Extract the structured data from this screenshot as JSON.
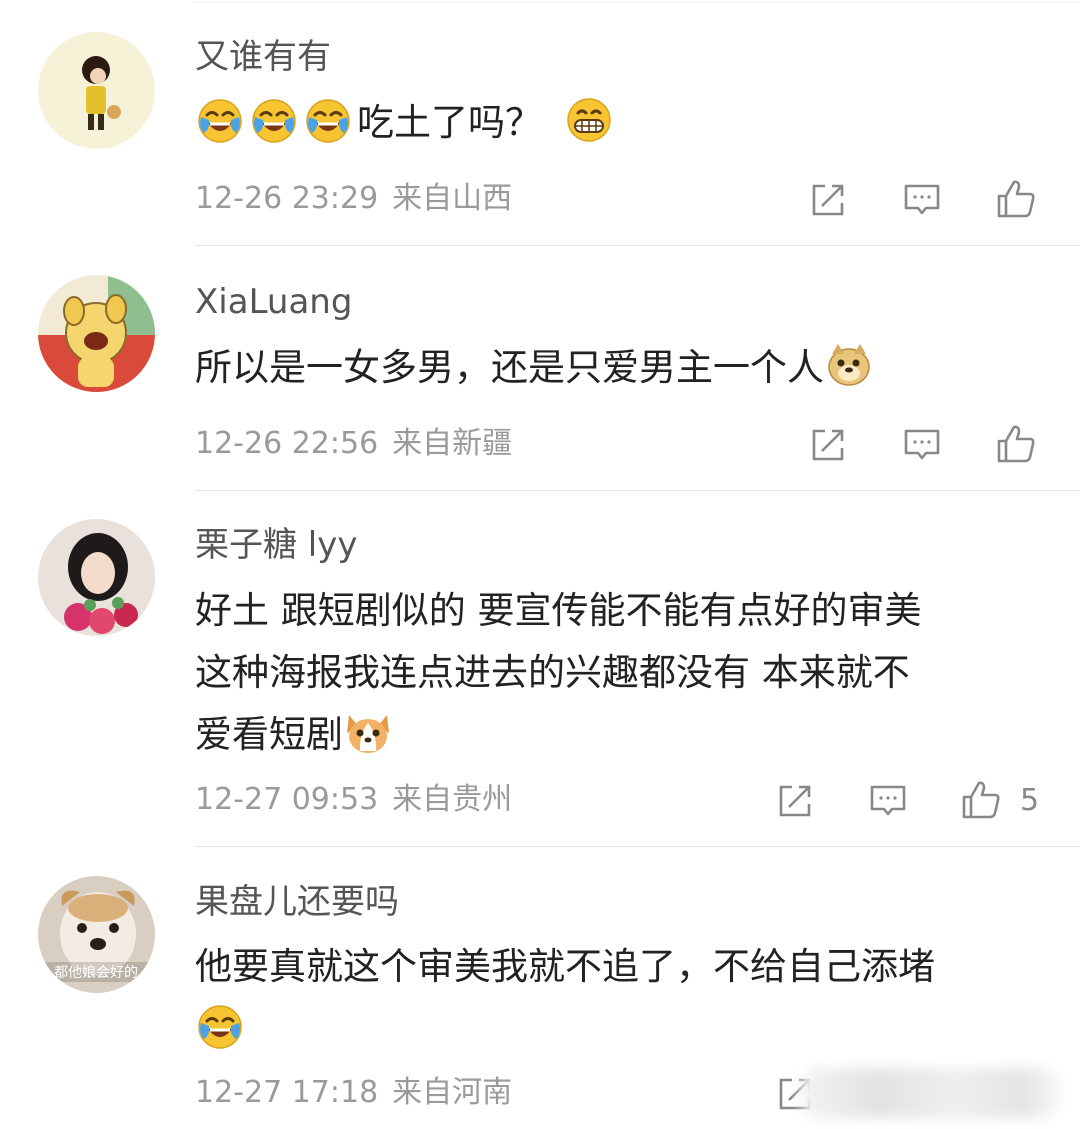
{
  "comments": [
    {
      "username": "又谁有有",
      "text_lines": [
        "吃土了吗？"
      ],
      "time": "12-26 23:29",
      "location": "来自山西",
      "like_count": ""
    },
    {
      "username": "XiaLuang",
      "text_lines": [
        "所以是一女多男，还是只爱男主一个人"
      ],
      "time": "12-26 22:56",
      "location": "来自新疆",
      "like_count": ""
    },
    {
      "username": "栗子糖 lyy",
      "text_lines": [
        "好土  跟短剧似的  要宣传能不能有点好的审美",
        "这种海报我连点进去的兴趣都没有   本来就不",
        "爱看短剧"
      ],
      "time": "12-27 09:53",
      "location": "来自贵州",
      "like_count": "5"
    },
    {
      "username": "果盘儿还要吗",
      "text_lines": [
        "他要真就这个审美我就不追了，不给自己添堵"
      ],
      "avatar_caption": "都他娘会好的",
      "time": "12-27 17:18",
      "location": "来自河南",
      "like_count": ""
    }
  ],
  "icons": {
    "emoji_laugh_cry": "laugh-cry-emoji",
    "emoji_grin": "grin-emoji",
    "emoji_doge": "doge-emoji",
    "emoji_corgi": "corgi-emoji",
    "repost": "repost-icon",
    "comment": "comment-icon",
    "like": "thumbs-up-icon"
  },
  "colors": {
    "username": "#555555",
    "text": "#222222",
    "meta": "#9a9a9a",
    "icon": "#888888",
    "divider": "#e6e6e6"
  }
}
